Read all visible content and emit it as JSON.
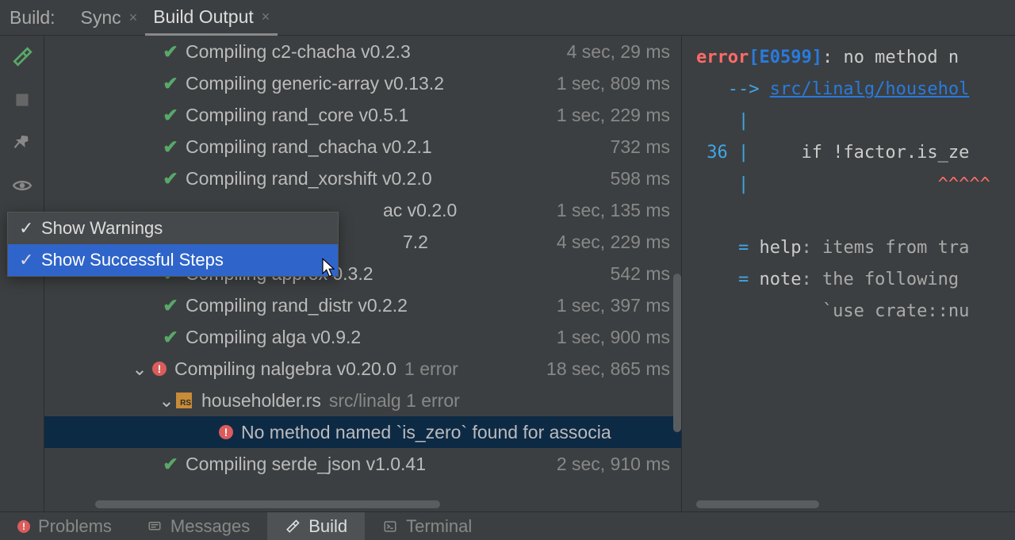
{
  "tabs": {
    "label": "Build:",
    "items": [
      {
        "label": "Sync",
        "active": false
      },
      {
        "label": "Build Output",
        "active": true
      }
    ]
  },
  "popup": {
    "items": [
      {
        "label": "Show Warnings",
        "checked": true,
        "selected": false
      },
      {
        "label": "Show Successful Steps",
        "checked": true,
        "selected": true
      }
    ]
  },
  "tree": [
    {
      "indent": 146,
      "status": "ok",
      "text": "Compiling c2-chacha v0.2.3",
      "time": "4 sec, 29 ms"
    },
    {
      "indent": 146,
      "status": "ok",
      "text": "Compiling generic-array v0.13.2",
      "time": "1 sec, 809 ms"
    },
    {
      "indent": 146,
      "status": "ok",
      "text": "Compiling rand_core v0.5.1",
      "time": "1 sec, 229 ms"
    },
    {
      "indent": 146,
      "status": "ok",
      "text": "Compiling rand_chacha v0.2.1",
      "time": "732 ms"
    },
    {
      "indent": 146,
      "status": "ok",
      "text": "Compiling rand_xorshift v0.2.0",
      "time": "598 ms"
    },
    {
      "indent": 146,
      "status": "none",
      "text": "ac v0.2.0",
      "leftpad": 395,
      "time": "1 sec, 135 ms"
    },
    {
      "indent": 146,
      "status": "none",
      "text": "7.2",
      "leftpad": 420,
      "time": "4 sec, 229 ms"
    },
    {
      "indent": 146,
      "status": "ok",
      "text": "Compiling approx     0.3.2",
      "cuttext": "Compiling approx",
      "tail": "0.3.2",
      "cutleft": 418,
      "time": "542 ms"
    },
    {
      "indent": 146,
      "status": "ok",
      "text": "Compiling rand_distr v0.2.2",
      "time": "1 sec, 397 ms"
    },
    {
      "indent": 146,
      "status": "ok",
      "text": "Compiling alga v0.9.2",
      "time": "1 sec, 900 ms"
    },
    {
      "indent": 110,
      "status": "err",
      "chev": true,
      "text": "Compiling nalgebra v0.20.0",
      "extra": "1 error",
      "time": "18 sec, 865 ms"
    },
    {
      "indent": 144,
      "status": "rs",
      "chev": true,
      "text": "householder.rs",
      "extra": "src/linalg 1 error"
    },
    {
      "indent": 216,
      "status": "err",
      "selected": true,
      "text": "No method named `is_zero` found for associa"
    },
    {
      "indent": 146,
      "status": "ok",
      "text": "Compiling serde_json v1.0.41",
      "time": "2 sec, 910 ms"
    }
  ],
  "console": {
    "lines": [
      {
        "segs": [
          {
            "c": "c-red",
            "t": "error"
          },
          {
            "c": "c-bb",
            "t": "[E0599]"
          },
          {
            "c": "c-white",
            "t": ": no method n"
          }
        ]
      },
      {
        "segs": [
          {
            "c": "c-bluet",
            "t": "   --> "
          },
          {
            "c": "c-blue",
            "t": "src/linalg/househol"
          }
        ]
      },
      {
        "segs": [
          {
            "c": "c-bluet",
            "t": "    |"
          }
        ]
      },
      {
        "segs": [
          {
            "c": "c-bluet",
            "t": " 36 |"
          },
          {
            "c": "c-white",
            "t": "     if !factor.is_ze"
          }
        ]
      },
      {
        "segs": [
          {
            "c": "c-bluet",
            "t": "    |"
          },
          {
            "c": "c-redu",
            "t": "                  ^^^^^"
          }
        ]
      },
      {
        "segs": [
          {
            "c": "c-white",
            "t": " "
          }
        ]
      },
      {
        "segs": [
          {
            "c": "c-bluet",
            "t": "    = "
          },
          {
            "c": "c-white",
            "t": "help"
          },
          {
            "c": "c-gray",
            "t": ": items from tra"
          }
        ]
      },
      {
        "segs": [
          {
            "c": "c-bluet",
            "t": "    = "
          },
          {
            "c": "c-white",
            "t": "note"
          },
          {
            "c": "c-gray",
            "t": ": the following "
          }
        ]
      },
      {
        "segs": [
          {
            "c": "c-gray",
            "t": "            `use crate::nu"
          }
        ]
      }
    ]
  },
  "statusbar": [
    {
      "name": "problems",
      "label": "Problems",
      "icon": "err"
    },
    {
      "name": "messages",
      "label": "Messages",
      "icon": "msg"
    },
    {
      "name": "build",
      "label": "Build",
      "icon": "hammer",
      "active": true
    },
    {
      "name": "terminal",
      "label": "Terminal",
      "icon": "term"
    }
  ]
}
